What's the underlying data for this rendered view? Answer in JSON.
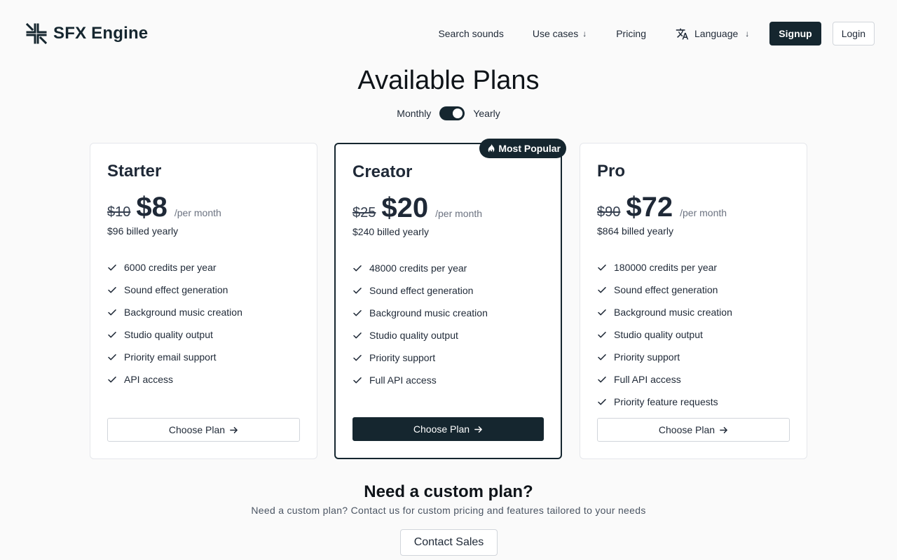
{
  "brand": {
    "name": "SFX Engine"
  },
  "nav": {
    "search": "Search sounds",
    "use_cases": "Use cases",
    "pricing": "Pricing",
    "language": "Language",
    "signup": "Signup",
    "login": "Login"
  },
  "hero": {
    "title": "Available Plans",
    "monthly": "Monthly",
    "yearly": "Yearly",
    "billing_toggle_on": true
  },
  "plans": [
    {
      "name": "Starter",
      "old_price": "$10",
      "price": "$8",
      "period": "/per month",
      "billed": "$96 billed yearly",
      "features": [
        "6000 credits per year",
        "Sound effect generation",
        "Background music creation",
        "Studio quality output",
        "Priority email support",
        "API access"
      ],
      "cta": "Choose Plan"
    },
    {
      "name": "Creator",
      "badge": "Most Popular",
      "old_price": "$25",
      "price": "$20",
      "period": "/per month",
      "billed": "$240 billed yearly",
      "features": [
        "48000 credits per year",
        "Sound effect generation",
        "Background music creation",
        "Studio quality output",
        "Priority support",
        "Full API access"
      ],
      "cta": "Choose Plan"
    },
    {
      "name": "Pro",
      "old_price": "$90",
      "price": "$72",
      "period": "/per month",
      "billed": "$864 billed yearly",
      "features": [
        "180000 credits per year",
        "Sound effect generation",
        "Background music creation",
        "Studio quality output",
        "Priority support",
        "Full API access",
        "Priority feature requests"
      ],
      "cta": "Choose Plan"
    }
  ],
  "custom": {
    "title": "Need a custom plan?",
    "subtitle": "Need a custom plan? Contact us for custom pricing and features tailored to your needs",
    "cta": "Contact Sales"
  },
  "colors": {
    "primary": "#15262f",
    "background": "#fafafa",
    "card": "#ffffff",
    "border": "#e5e7eb"
  }
}
